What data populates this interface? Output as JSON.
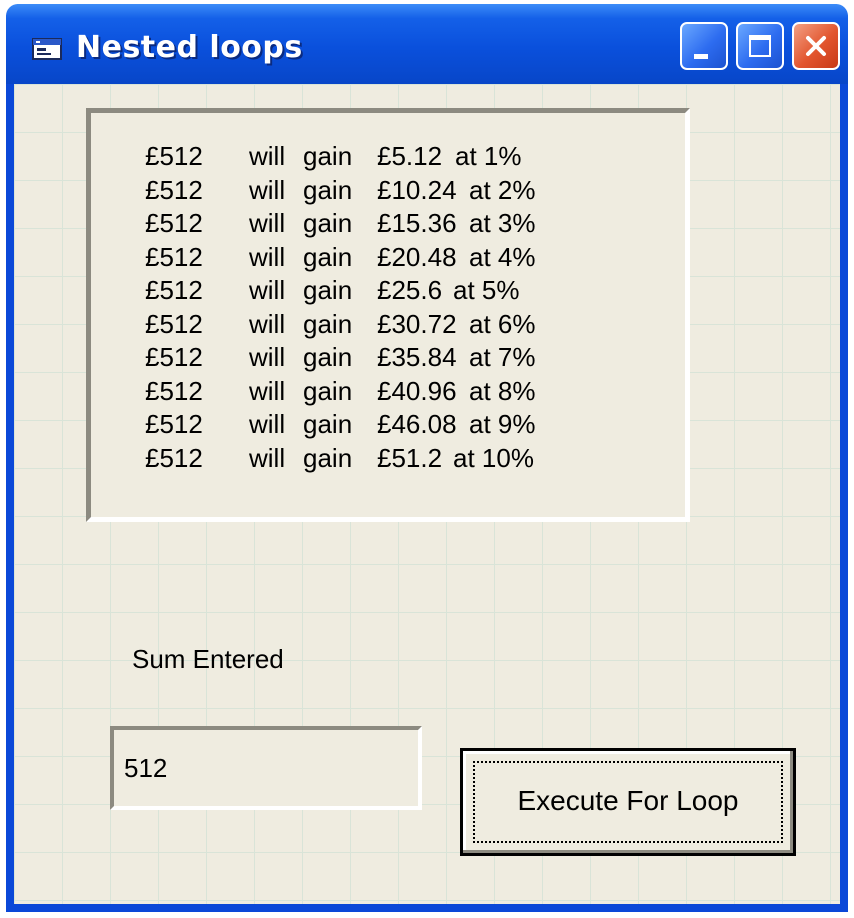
{
  "window": {
    "title": "Nested loops",
    "icons": {
      "app": "form-icon",
      "minimize": "minimize-icon",
      "maximize": "maximize-icon",
      "close": "close-icon"
    },
    "colors": {
      "titlebar": "#0a50dc",
      "client": "#efece0",
      "close_button": "#e2552e"
    }
  },
  "output": {
    "rows": [
      {
        "sum": "£512",
        "will": "will",
        "gain": "gain",
        "amount": "£5.12",
        "rate": "at 1%"
      },
      {
        "sum": "£512",
        "will": "will",
        "gain": "gain",
        "amount": "£10.24",
        "rate": "at 2%"
      },
      {
        "sum": "£512",
        "will": "will",
        "gain": "gain",
        "amount": "£15.36",
        "rate": "at 3%"
      },
      {
        "sum": "£512",
        "will": "will",
        "gain": "gain",
        "amount": "£20.48",
        "rate": "at 4%"
      },
      {
        "sum": "£512",
        "will": "will",
        "gain": "gain",
        "amount": "£25.6",
        "rate": "at 5%"
      },
      {
        "sum": "£512",
        "will": "will",
        "gain": "gain",
        "amount": "£30.72",
        "rate": "at 6%"
      },
      {
        "sum": "£512",
        "will": "will",
        "gain": "gain",
        "amount": "£35.84",
        "rate": "at 7%"
      },
      {
        "sum": "£512",
        "will": "will",
        "gain": "gain",
        "amount": "£40.96",
        "rate": "at 8%"
      },
      {
        "sum": "£512",
        "will": "will",
        "gain": "gain",
        "amount": "£46.08",
        "rate": "at 9%"
      },
      {
        "sum": "£512",
        "will": "will",
        "gain": "gain",
        "amount": "£51.2",
        "rate": "at 10%"
      }
    ]
  },
  "form": {
    "sum_label": "Sum Entered",
    "sum_value": "512",
    "execute_label": "Execute For Loop"
  }
}
